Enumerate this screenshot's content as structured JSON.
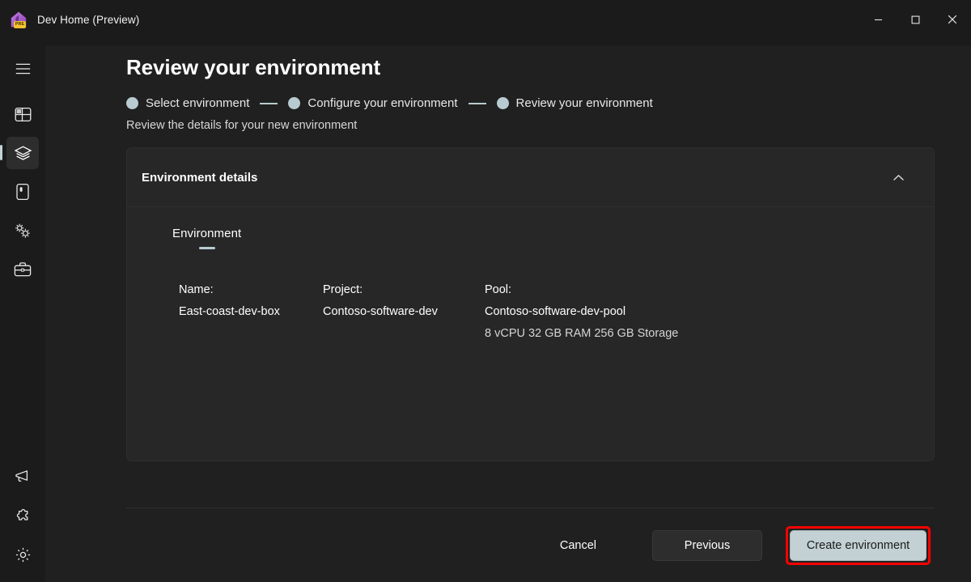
{
  "window": {
    "title": "Dev Home (Preview)",
    "icon_badge": "PRE",
    "minimize_label": "Minimize",
    "maximize_label": "Maximize",
    "close_label": "Close"
  },
  "sidebar": {
    "menu_label": "Navigation menu",
    "items": [
      {
        "name": "dashboard",
        "label": "Dashboard",
        "selected": false
      },
      {
        "name": "environments",
        "label": "Environments",
        "selected": true
      },
      {
        "name": "machine-configuration",
        "label": "Machine configuration",
        "selected": false
      },
      {
        "name": "extensions",
        "label": "Extensions",
        "selected": false
      },
      {
        "name": "utilities",
        "label": "Utilities",
        "selected": false
      }
    ],
    "bottom_items": [
      {
        "name": "feedback",
        "label": "Feedback"
      },
      {
        "name": "extensions-library",
        "label": "Extensions library"
      },
      {
        "name": "settings",
        "label": "Settings"
      }
    ]
  },
  "page": {
    "title": "Review your environment",
    "subtitle": "Review the details for your new environment",
    "stepper": [
      {
        "label": "Select environment"
      },
      {
        "label": "Configure your environment"
      },
      {
        "label": "Review your environment"
      }
    ]
  },
  "card": {
    "header_title": "Environment details",
    "collapse_icon": "chevron-up-icon",
    "tab": {
      "label": "Environment"
    },
    "fields": [
      {
        "label": "Name:",
        "value": "East-coast-dev-box",
        "sub": ""
      },
      {
        "label": "Project:",
        "value": "Contoso-software-dev",
        "sub": ""
      },
      {
        "label": "Pool:",
        "value": "Contoso-software-dev-pool",
        "sub": "8 vCPU 32 GB RAM 256 GB Storage"
      }
    ]
  },
  "footer": {
    "cancel_label": "Cancel",
    "previous_label": "Previous",
    "create_label": "Create environment"
  },
  "colors": {
    "page_background": "#202020",
    "sidebar_background": "#1b1b1b",
    "card_background": "#272727",
    "accent": "#b8cbd0",
    "primary_button": "#c3d1d4",
    "highlight_border": "#ff0000"
  }
}
